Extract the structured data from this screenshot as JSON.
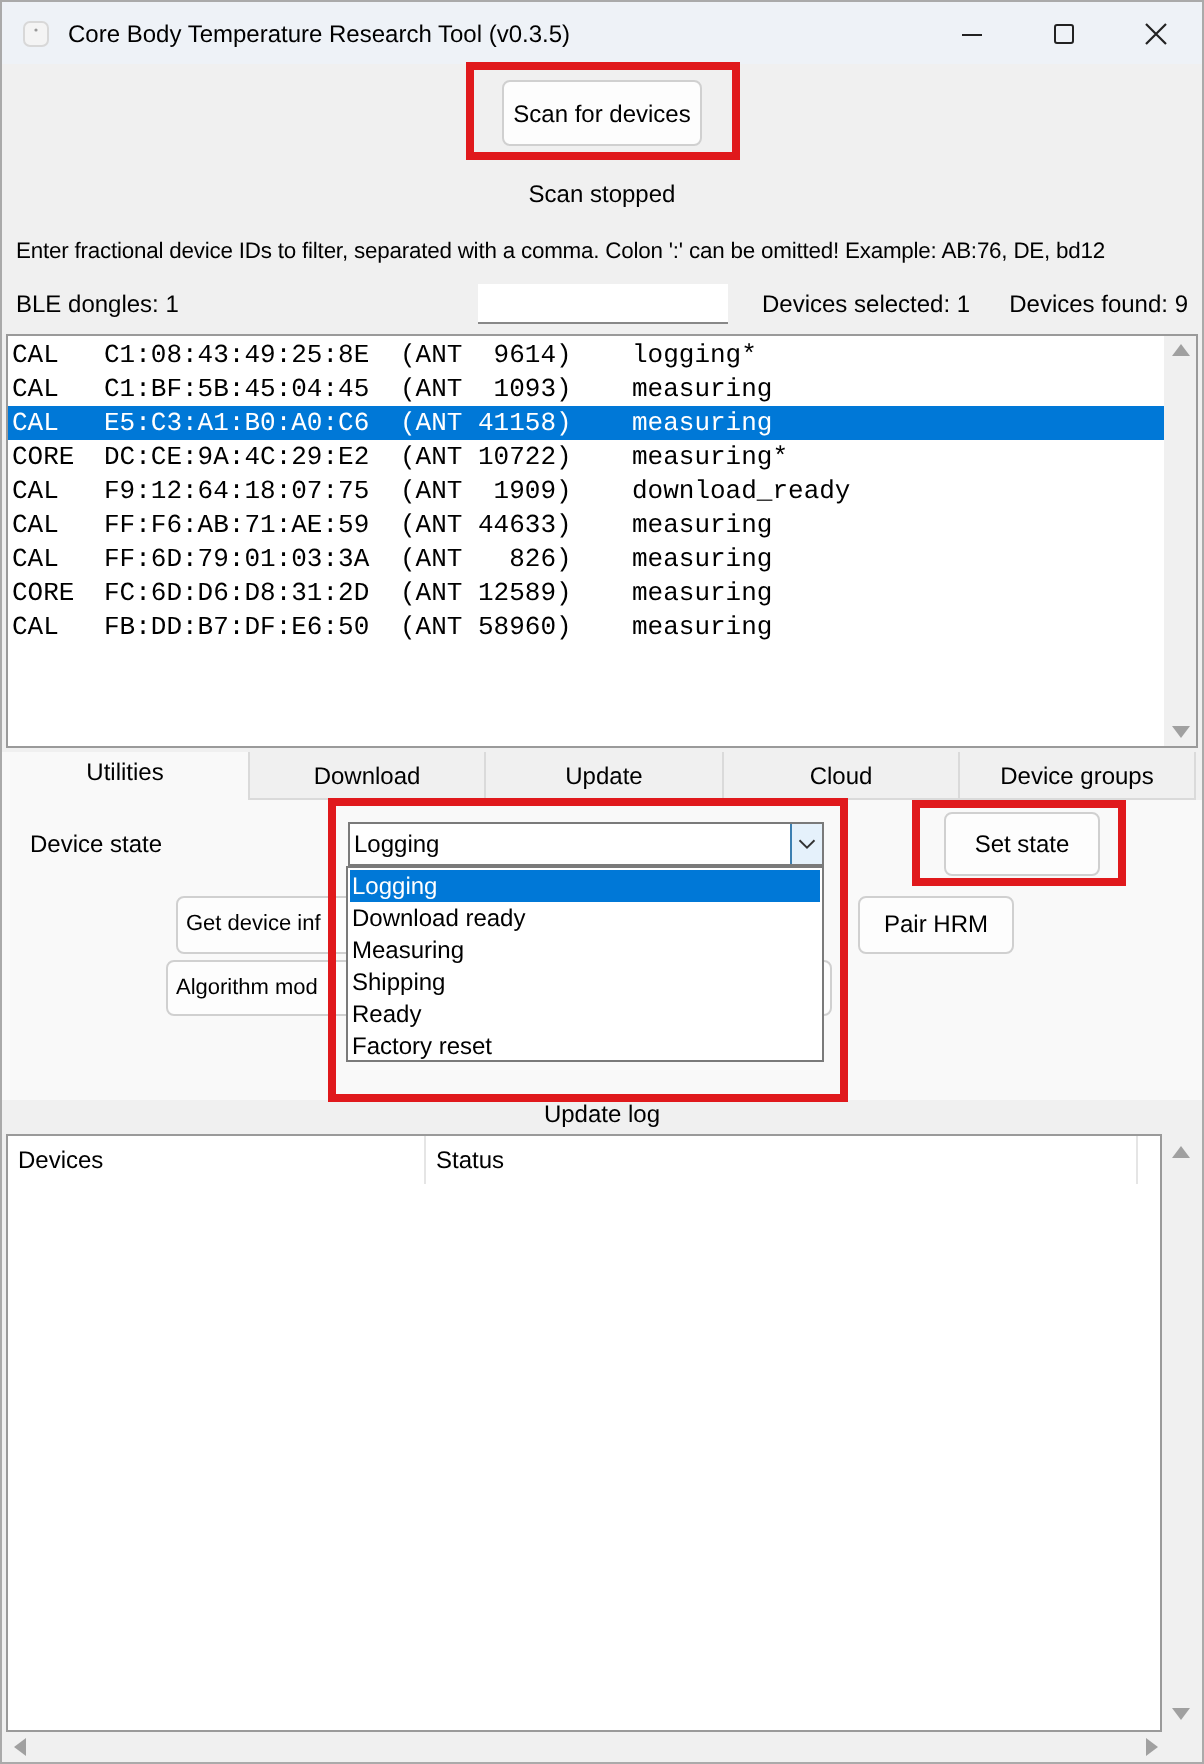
{
  "window": {
    "title": "Core Body Temperature Research Tool (v0.3.5)"
  },
  "scan_button": {
    "label": "Scan for devices",
    "highlighted": true
  },
  "scan_status": "Scan stopped",
  "filter_hint": "Enter fractional device IDs to filter, separated with a comma. Colon ':' can be omitted! Example: AB:76, DE, bd12",
  "ble_dongles": "BLE dongles: 1",
  "devices_selected": "Devices selected: 1",
  "devices_found": "Devices found: 9",
  "devices": [
    {
      "type": "CAL",
      "address": "C1:08:43:49:25:8E",
      "ant": "(ANT  9614)",
      "state": "logging*",
      "selected": false
    },
    {
      "type": "CAL",
      "address": "C1:BF:5B:45:04:45",
      "ant": "(ANT  1093)",
      "state": "measuring",
      "selected": false
    },
    {
      "type": "CAL",
      "address": "E5:C3:A1:B0:A0:C6",
      "ant": "(ANT 41158)",
      "state": "measuring",
      "selected": true
    },
    {
      "type": "CORE",
      "address": "DC:CE:9A:4C:29:E2",
      "ant": "(ANT 10722)",
      "state": "measuring*",
      "selected": false
    },
    {
      "type": "CAL",
      "address": "F9:12:64:18:07:75",
      "ant": "(ANT  1909)",
      "state": "download_ready",
      "selected": false
    },
    {
      "type": "CAL",
      "address": "FF:F6:AB:71:AE:59",
      "ant": "(ANT 44633)",
      "state": "measuring",
      "selected": false
    },
    {
      "type": "CAL",
      "address": "FF:6D:79:01:03:3A",
      "ant": "(ANT   826)",
      "state": "measuring",
      "selected": false
    },
    {
      "type": "CORE",
      "address": "FC:6D:D6:D8:31:2D",
      "ant": "(ANT 12589)",
      "state": "measuring",
      "selected": false
    },
    {
      "type": "CAL",
      "address": "FB:DD:B7:DF:E6:50",
      "ant": "(ANT 58960)",
      "state": "measuring",
      "selected": false
    }
  ],
  "tabs": [
    {
      "label": "Utilities",
      "selected": true
    },
    {
      "label": "Download",
      "selected": false
    },
    {
      "label": "Update",
      "selected": false
    },
    {
      "label": "Cloud",
      "selected": false
    },
    {
      "label": "Device groups",
      "selected": false
    }
  ],
  "utilities": {
    "device_state_label": "Device state",
    "state_combo": {
      "value": "Logging",
      "expanded": true,
      "highlighted": true,
      "options": [
        {
          "label": "Logging",
          "selected": true
        },
        {
          "label": "Download ready",
          "selected": false
        },
        {
          "label": "Measuring",
          "selected": false
        },
        {
          "label": "Shipping",
          "selected": false
        },
        {
          "label": "Ready",
          "selected": false
        },
        {
          "label": "Factory reset",
          "selected": false
        }
      ]
    },
    "set_state_button": {
      "label": "Set state",
      "highlighted": true
    },
    "get_info_button": {
      "label": "Get device inf"
    },
    "pair_button": {
      "label": "Pair HRM"
    },
    "algorithm_button": {
      "label": "Algorithm mod"
    }
  },
  "update_log": {
    "title": "Update log",
    "columns": [
      "Devices",
      "Status"
    ]
  }
}
